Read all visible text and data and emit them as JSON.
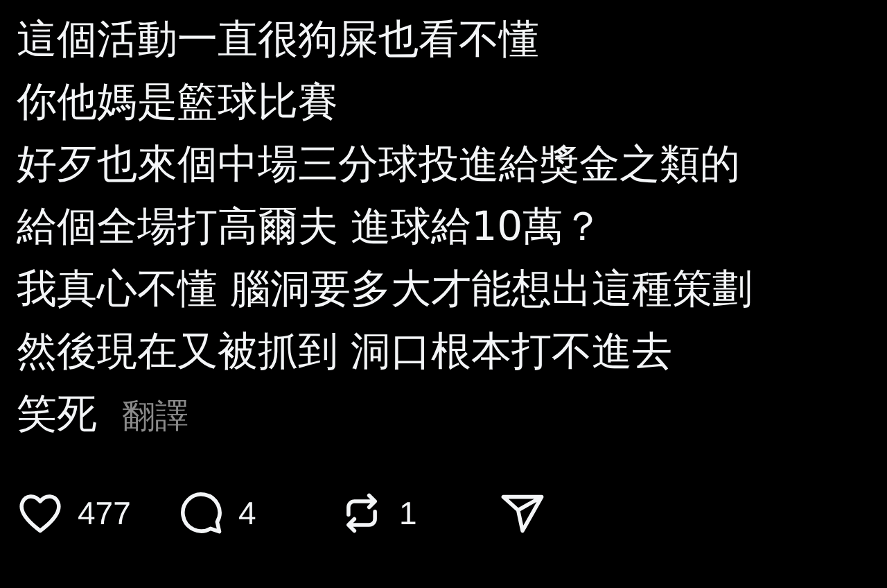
{
  "post": {
    "lines": [
      "這個活動一直很狗屎也看不懂",
      "你他媽是籃球比賽",
      "好歹也來個中場三分球投進給獎金之類的",
      "給個全場打高爾夫 進球給10萬？",
      "我真心不懂 腦洞要多大才能想出這種策劃",
      "然後現在又被抓到 洞口根本打不進去",
      "笑死"
    ],
    "translate_link": "翻譯"
  },
  "actions": [
    {
      "kind": "like",
      "count": "477"
    },
    {
      "kind": "reply",
      "count": "4"
    },
    {
      "kind": "repost",
      "count": "1"
    },
    {
      "kind": "share"
    }
  ]
}
